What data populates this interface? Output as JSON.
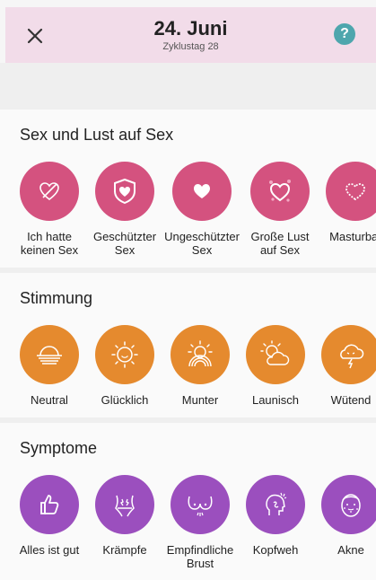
{
  "header": {
    "date": "24. Juni",
    "cycle_day": "Zyklustag 28",
    "help_label": "?",
    "background": "#f2dce9",
    "help_color": "#4ea6ad"
  },
  "sections": {
    "sex": {
      "title": "Sex und Lust auf Sex",
      "color": "#d4527f",
      "items": [
        {
          "label": "Ich hatte\nkeinen Sex",
          "icon": "crossed-heart-icon"
        },
        {
          "label": "Geschützter\nSex",
          "icon": "shield-heart-icon"
        },
        {
          "label": "Ungeschützter\nSex",
          "icon": "heart-icon"
        },
        {
          "label": "Große Lust\nauf Sex",
          "icon": "hearts-icon"
        },
        {
          "label": "Masturbat",
          "icon": "heart-outline-icon"
        }
      ]
    },
    "mood": {
      "title": "Stimmung",
      "color": "#e58a2e",
      "items": [
        {
          "label": "Neutral",
          "icon": "horizon-sun-icon"
        },
        {
          "label": "Glücklich",
          "icon": "sun-icon"
        },
        {
          "label": "Munter",
          "icon": "rainbow-sun-icon"
        },
        {
          "label": "Launisch",
          "icon": "sun-cloud-icon"
        },
        {
          "label": "Wütend",
          "icon": "storm-cloud-icon"
        }
      ]
    },
    "symptoms": {
      "title": "Symptome",
      "color": "#9b4fbe",
      "items": [
        {
          "label": "Alles ist gut",
          "icon": "thumbs-up-icon"
        },
        {
          "label": "Krämpfe",
          "icon": "cramps-icon"
        },
        {
          "label": "Empfindliche\nBrust",
          "icon": "breast-icon"
        },
        {
          "label": "Kopfweh",
          "icon": "headache-icon"
        },
        {
          "label": "Akne",
          "icon": "acne-icon"
        }
      ]
    }
  }
}
